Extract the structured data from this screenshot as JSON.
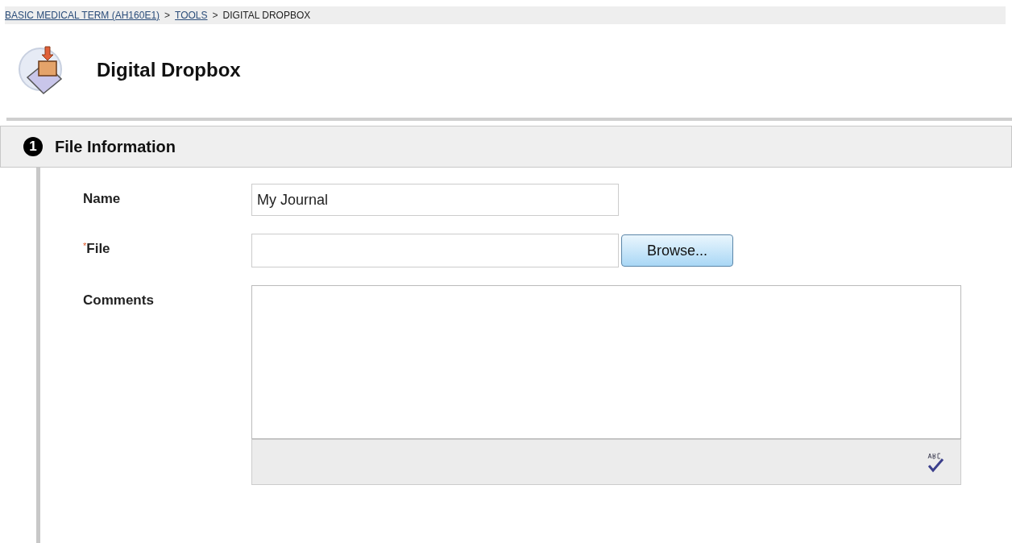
{
  "breadcrumb": [
    {
      "label": "BASIC MEDICAL TERM (AH160E1)",
      "link": true
    },
    {
      "label": "TOOLS",
      "link": true
    },
    {
      "label": "DIGITAL DROPBOX",
      "link": false
    }
  ],
  "breadcrumb_separator": ">",
  "page_title": "Digital Dropbox",
  "section": {
    "step": "1",
    "title": "File Information"
  },
  "fields": [
    {
      "kind": "text",
      "label": "Name",
      "required": false,
      "value": "My Journal"
    },
    {
      "kind": "file",
      "label": "File",
      "required": true,
      "button": "Browse..."
    },
    {
      "kind": "textarea",
      "label": "Comments",
      "required": false
    }
  ],
  "required_mark": "*"
}
